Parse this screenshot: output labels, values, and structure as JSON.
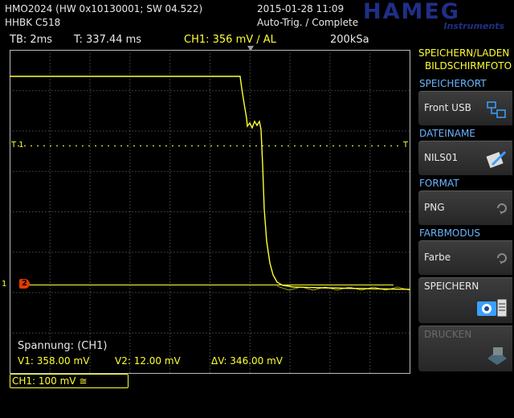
{
  "header": {
    "device_line": "HMO2024 (HW 0x10130001; SW 04.522)",
    "datetime": "2015-01-28 11:09",
    "device_name": "HHBK C518",
    "trigger_status": "Auto-Trig. / Complete",
    "logo_brand": "HAMEG",
    "logo_sub": "Instruments"
  },
  "status_bar": {
    "timebase": "TB: 2ms",
    "trigger_time": "T: 337.44 ms",
    "trigger_info": "CH1: 356 mV ∕ AL",
    "sample_rate": "200kSa"
  },
  "scope": {
    "trigger_level_marker": "T 1",
    "trigger_right_marker": "T",
    "ground_marker": "1",
    "channel_marker": "2",
    "channel_label": "CH1: 100 mV ≅",
    "measurement_title": "Spannung: (CH1)",
    "v1": "V1: 358.00 mV",
    "v2": "V2: 12.00 mV",
    "dv": "ΔV: 346.00 mV",
    "trace_color": "#ffff33"
  },
  "side_menu": {
    "title_line1": "SPEICHERN/LADEN",
    "title_line2": "BILDSCHIRMFOTO",
    "speicherort_title": "SPEICHERORT",
    "speicherort_value": "Front USB",
    "dateiname_title": "DATEINAME",
    "dateiname_value": "NILS01",
    "format_title": "FORMAT",
    "format_value": "PNG",
    "farbmodus_title": "FARBMODUS",
    "farbmodus_value": "Farbe",
    "save_label": "SPEICHERN",
    "print_label": "DRUCKEN",
    "icons": [
      "usb-storage-icon",
      "file-edit-icon",
      "cycle-arrow-icon",
      "camera-save-icon",
      "printer-icon"
    ]
  }
}
